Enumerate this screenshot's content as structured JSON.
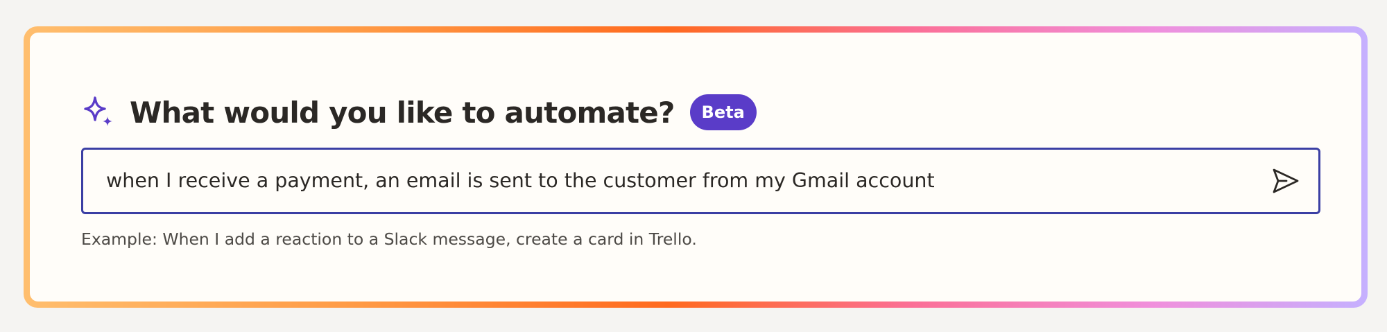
{
  "prompt_card": {
    "title": "What would you like to automate?",
    "badge": "Beta",
    "input_value": "when I receive a payment, an email is sent to the customer from my Gmail account",
    "example_text": "Example: When I add a reaction to a Slack message, create a card in Trello.",
    "icons": {
      "title_icon": "sparkle-icon",
      "submit_icon": "send-icon"
    },
    "colors": {
      "accent": "#5a3cc8",
      "input_border": "#3b3fa4",
      "gradient": [
        "#ffbe6e",
        "#ff6a1f",
        "#fb6f96",
        "#f08fdc",
        "#c5b0ff"
      ]
    }
  }
}
